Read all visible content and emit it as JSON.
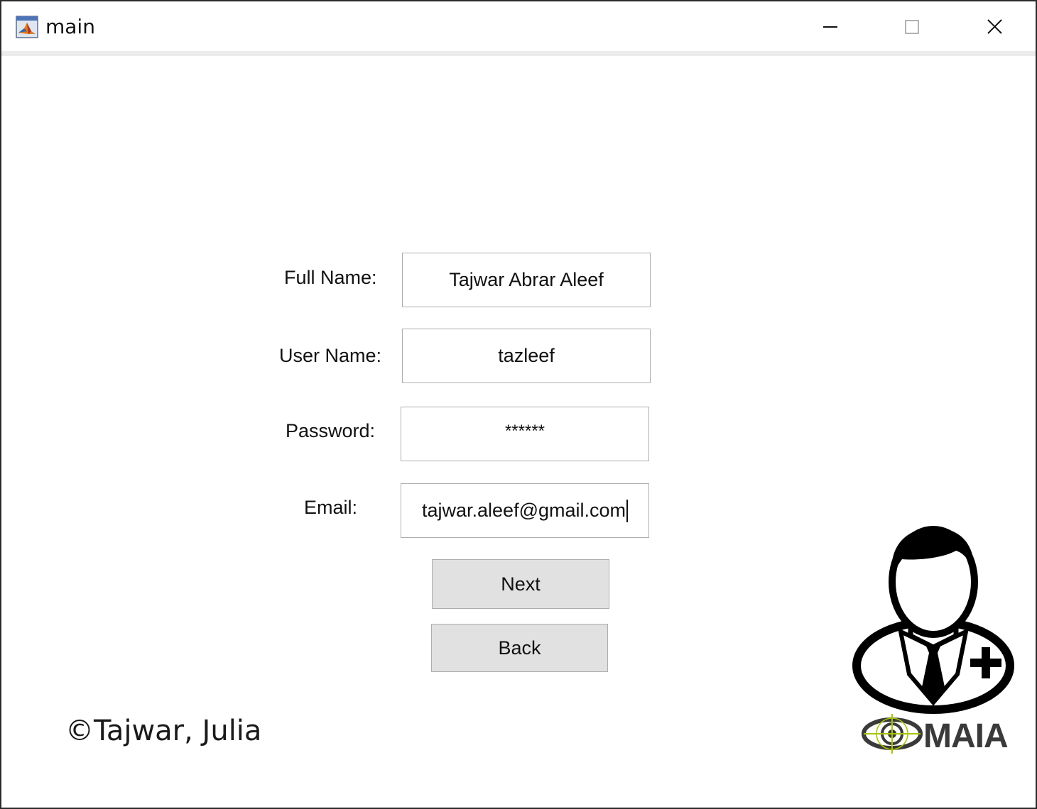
{
  "window": {
    "title": "main",
    "icon": "matlab-icon",
    "controls": [
      "minimize-icon",
      "maximize-icon",
      "close-icon"
    ]
  },
  "form": {
    "full_name": {
      "label": "Full Name:",
      "value": "Tajwar Abrar Aleef"
    },
    "user_name": {
      "label": "User Name:",
      "value": "tazleef"
    },
    "password": {
      "label": "Password:",
      "value": "******"
    },
    "email": {
      "label": "Email:",
      "value": "tajwar.aleef@gmail.com"
    }
  },
  "buttons": {
    "next": "Next",
    "back": "Back"
  },
  "footer": {
    "copyright": "©Tajwar, Julia",
    "logo_text": "MAIA",
    "avatar_icon": "add-doctor-user-icon"
  },
  "colors": {
    "button_bg": "#e1e1e1",
    "logo_accent": "#a8c400",
    "logo_text": "#3a3a3a"
  }
}
